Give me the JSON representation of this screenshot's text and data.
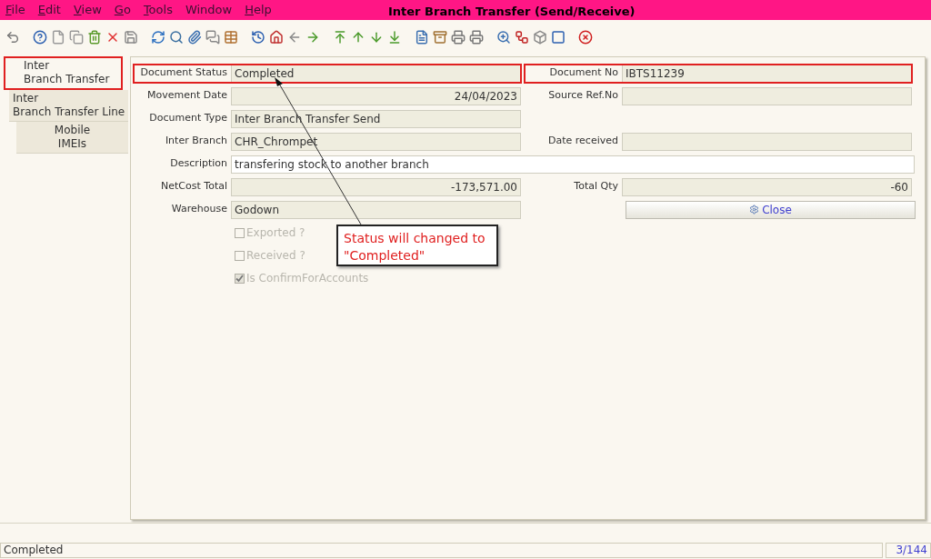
{
  "window": {
    "title": "Inter Branch Transfer (Send/Receive)"
  },
  "menu": [
    {
      "label": "File",
      "mnemonic": true
    },
    {
      "label": "Edit",
      "mnemonic": true
    },
    {
      "label": "View",
      "mnemonic": true
    },
    {
      "label": "Go",
      "mnemonic": true
    },
    {
      "label": "Tools",
      "mnemonic": true
    },
    {
      "label": "Window",
      "mnemonic": false
    },
    {
      "label": "Help",
      "mnemonic": true
    }
  ],
  "tabs": [
    {
      "label": "Inter\nBranch Transfer",
      "selected": true,
      "highlighted": true
    },
    {
      "label": "Inter\nBranch Transfer Line",
      "selected": false,
      "highlighted": false
    },
    {
      "label": "Mobile\nIMEIs",
      "selected": false,
      "highlighted": false
    }
  ],
  "form": {
    "rows": [
      {
        "fields": [
          {
            "kind": "text",
            "label": "Document Status",
            "value": "Completed",
            "readonly": true,
            "highlighted": true
          },
          {
            "kind": "text",
            "label": "Document No",
            "value": "IBTS11239",
            "readonly": true,
            "highlighted": true
          }
        ]
      },
      {
        "fields": [
          {
            "kind": "number",
            "label": "Movement Date",
            "value": "24/04/2023",
            "readonly": true,
            "highlighted": false
          },
          {
            "kind": "text",
            "label": "Source Ref.No",
            "readonly": true,
            "highlighted": false
          }
        ]
      },
      {
        "fields": [
          {
            "kind": "text",
            "label": "Document Type",
            "value": "Inter Branch Transfer Send",
            "readonly": true,
            "highlighted": false
          }
        ]
      },
      {
        "fields": [
          {
            "kind": "text",
            "label": "Inter Branch",
            "value": "CHR_Chrompet",
            "readonly": true,
            "highlighted": false
          },
          {
            "kind": "text",
            "label": "Date received",
            "readonly": true,
            "highlighted": false
          }
        ]
      },
      {
        "fields": [
          {
            "kind": "wide",
            "label": "Description",
            "value": "transfering stock to another branch",
            "readonly": false,
            "highlighted": false
          }
        ]
      },
      {
        "fields": [
          {
            "kind": "number",
            "label": "NetCost Total",
            "value": "-173,571.00",
            "readonly": true,
            "highlighted": false
          },
          {
            "kind": "number",
            "label": "Total Qty",
            "value": "-60",
            "readonly": true,
            "highlighted": false
          }
        ]
      },
      {
        "fields": [
          {
            "kind": "text",
            "label": "Warehouse",
            "value": "Godown",
            "readonly": true,
            "highlighted": false
          },
          {
            "kind": "button",
            "label": "Close"
          }
        ]
      }
    ]
  },
  "checkboxes": [
    {
      "label": "Exported ?",
      "checked": false,
      "disabled": true
    },
    {
      "label": "Received ?",
      "checked": false,
      "disabled": true
    },
    {
      "label": "Is ConfirmForAccounts",
      "checked": true,
      "disabled": true
    }
  ],
  "callout": {
    "text": "Status will changed to\n\"Completed\""
  },
  "status_bar": {
    "message": "Completed",
    "record": "3/144"
  }
}
